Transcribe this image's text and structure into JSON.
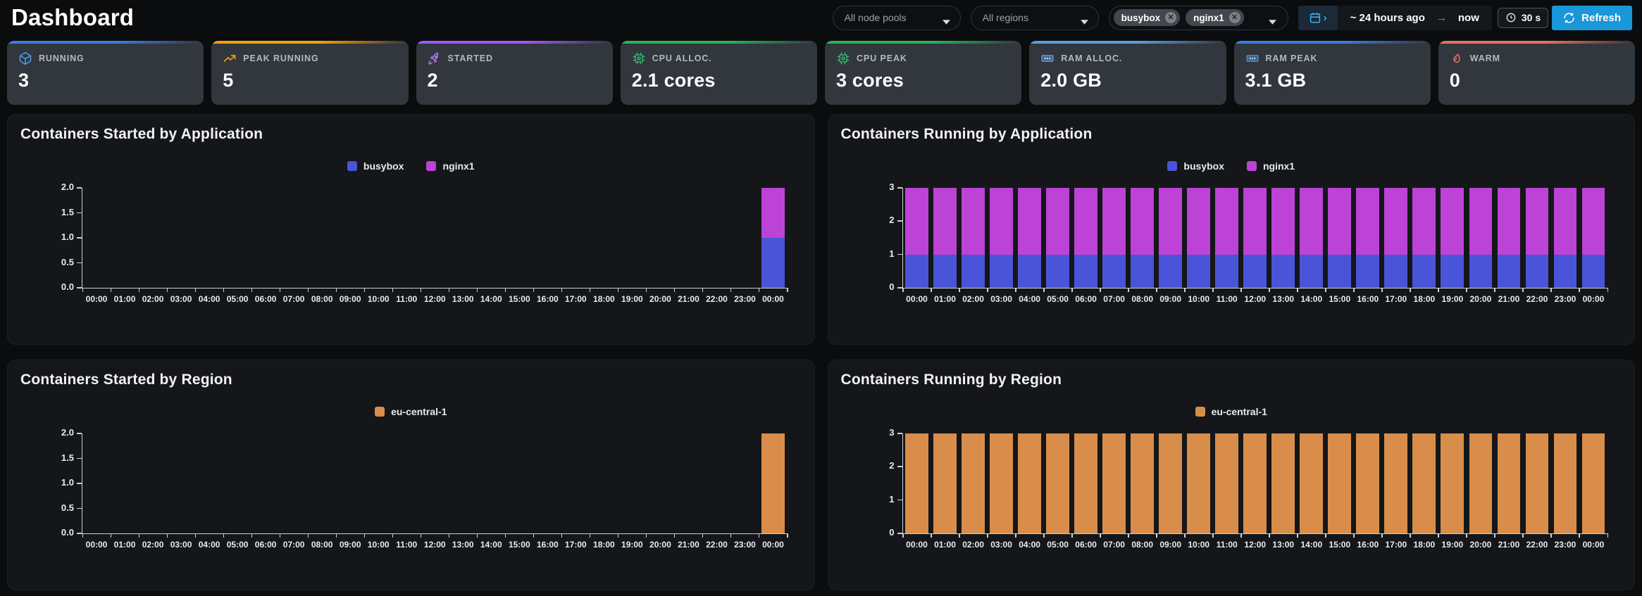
{
  "header": {
    "title": "Dashboard",
    "node_pools_select": "All node pools",
    "regions_select": "All regions",
    "tags": [
      "busybox",
      "nginx1"
    ],
    "time_from": "~ 24 hours ago",
    "arrow": "→",
    "time_to": "now",
    "interval": "30 s",
    "refresh_label": "Refresh",
    "refresh_color": "#1a97d8"
  },
  "stats": [
    {
      "label": "RUNNING",
      "value": "3",
      "icon": "cube-icon",
      "accent": "#3d7ee0",
      "icon_color": "#4e9de6"
    },
    {
      "label": "PEAK RUNNING",
      "value": "5",
      "icon": "trending-up-icon",
      "accent": "#f59e0b",
      "icon_color": "#f59e0b"
    },
    {
      "label": "STARTED",
      "value": "2",
      "icon": "rocket-icon",
      "accent": "#9a5cf5",
      "icon_color": "#ab7df0"
    },
    {
      "label": "CPU ALLOC.",
      "value": "2.1 cores",
      "icon": "cpu-icon",
      "accent": "#27b45f",
      "icon_color": "#2fba6b"
    },
    {
      "label": "CPU PEAK",
      "value": "3 cores",
      "icon": "cpu-icon",
      "accent": "#27b45f",
      "icon_color": "#2fba6b"
    },
    {
      "label": "RAM ALLOC.",
      "value": "2.0 GB",
      "icon": "memory-icon",
      "accent": "#5b9de0",
      "icon_color": "#5b9de0"
    },
    {
      "label": "RAM PEAK",
      "value": "3.1 GB",
      "icon": "memory-icon",
      "accent": "#3d7ee0",
      "icon_color": "#4e8fe0"
    },
    {
      "label": "WARM",
      "value": "0",
      "icon": "flame-icon",
      "accent": "#e8705c",
      "icon_color": "#e8705c"
    }
  ],
  "chart_data": [
    {
      "type": "bar",
      "stacked": true,
      "title": "Containers Started by Application",
      "x": [
        "00:00",
        "01:00",
        "02:00",
        "03:00",
        "04:00",
        "05:00",
        "06:00",
        "07:00",
        "08:00",
        "09:00",
        "10:00",
        "11:00",
        "12:00",
        "13:00",
        "14:00",
        "15:00",
        "16:00",
        "17:00",
        "18:00",
        "19:00",
        "20:00",
        "21:00",
        "22:00",
        "23:00",
        "00:00"
      ],
      "series": [
        {
          "name": "busybox",
          "color": "#4a54d8",
          "values": [
            0,
            0,
            0,
            0,
            0,
            0,
            0,
            0,
            0,
            0,
            0,
            0,
            0,
            0,
            0,
            0,
            0,
            0,
            0,
            0,
            0,
            0,
            0,
            0,
            1
          ]
        },
        {
          "name": "nginx1",
          "color": "#bc43d6",
          "values": [
            0,
            0,
            0,
            0,
            0,
            0,
            0,
            0,
            0,
            0,
            0,
            0,
            0,
            0,
            0,
            0,
            0,
            0,
            0,
            0,
            0,
            0,
            0,
            0,
            1
          ]
        }
      ],
      "ymax": 2,
      "yticks": [
        "0.0",
        "0.5",
        "1.0",
        "1.5",
        "2.0"
      ],
      "legend_position": "top-center",
      "grid": false
    },
    {
      "type": "bar",
      "stacked": true,
      "title": "Containers Running by Application",
      "x": [
        "00:00",
        "01:00",
        "02:00",
        "03:00",
        "04:00",
        "05:00",
        "06:00",
        "07:00",
        "08:00",
        "09:00",
        "10:00",
        "11:00",
        "12:00",
        "13:00",
        "14:00",
        "15:00",
        "16:00",
        "17:00",
        "18:00",
        "19:00",
        "20:00",
        "21:00",
        "22:00",
        "23:00",
        "00:00"
      ],
      "series": [
        {
          "name": "busybox",
          "color": "#4a54d8",
          "values": [
            1,
            1,
            1,
            1,
            1,
            1,
            1,
            1,
            1,
            1,
            1,
            1,
            1,
            1,
            1,
            1,
            1,
            1,
            1,
            1,
            1,
            1,
            1,
            1,
            1
          ]
        },
        {
          "name": "nginx1",
          "color": "#bc43d6",
          "values": [
            2,
            2,
            2,
            2,
            2,
            2,
            2,
            2,
            2,
            2,
            2,
            2,
            2,
            2,
            2,
            2,
            2,
            2,
            2,
            2,
            2,
            2,
            2,
            2,
            2
          ]
        }
      ],
      "ymax": 3,
      "yticks": [
        "0",
        "1",
        "2",
        "3"
      ],
      "legend_position": "top-center",
      "grid": false
    },
    {
      "type": "bar",
      "stacked": true,
      "title": "Containers Started by Region",
      "x": [
        "00:00",
        "01:00",
        "02:00",
        "03:00",
        "04:00",
        "05:00",
        "06:00",
        "07:00",
        "08:00",
        "09:00",
        "10:00",
        "11:00",
        "12:00",
        "13:00",
        "14:00",
        "15:00",
        "16:00",
        "17:00",
        "18:00",
        "19:00",
        "20:00",
        "21:00",
        "22:00",
        "23:00",
        "00:00"
      ],
      "series": [
        {
          "name": "eu-central-1",
          "color": "#d88e4a",
          "values": [
            0,
            0,
            0,
            0,
            0,
            0,
            0,
            0,
            0,
            0,
            0,
            0,
            0,
            0,
            0,
            0,
            0,
            0,
            0,
            0,
            0,
            0,
            0,
            0,
            2
          ]
        }
      ],
      "ymax": 2,
      "yticks": [
        "0.0",
        "0.5",
        "1.0",
        "1.5",
        "2.0"
      ],
      "legend_position": "top-center",
      "grid": false
    },
    {
      "type": "bar",
      "stacked": true,
      "title": "Containers Running by Region",
      "x": [
        "00:00",
        "01:00",
        "02:00",
        "03:00",
        "04:00",
        "05:00",
        "06:00",
        "07:00",
        "08:00",
        "09:00",
        "10:00",
        "11:00",
        "12:00",
        "13:00",
        "14:00",
        "15:00",
        "16:00",
        "17:00",
        "18:00",
        "19:00",
        "20:00",
        "21:00",
        "22:00",
        "23:00",
        "00:00"
      ],
      "series": [
        {
          "name": "eu-central-1",
          "color": "#d88e4a",
          "values": [
            3,
            3,
            3,
            3,
            3,
            3,
            3,
            3,
            3,
            3,
            3,
            3,
            3,
            3,
            3,
            3,
            3,
            3,
            3,
            3,
            3,
            3,
            3,
            3,
            3
          ]
        }
      ],
      "ymax": 3,
      "yticks": [
        "0",
        "1",
        "2",
        "3"
      ],
      "legend_position": "top-center",
      "grid": false
    }
  ]
}
